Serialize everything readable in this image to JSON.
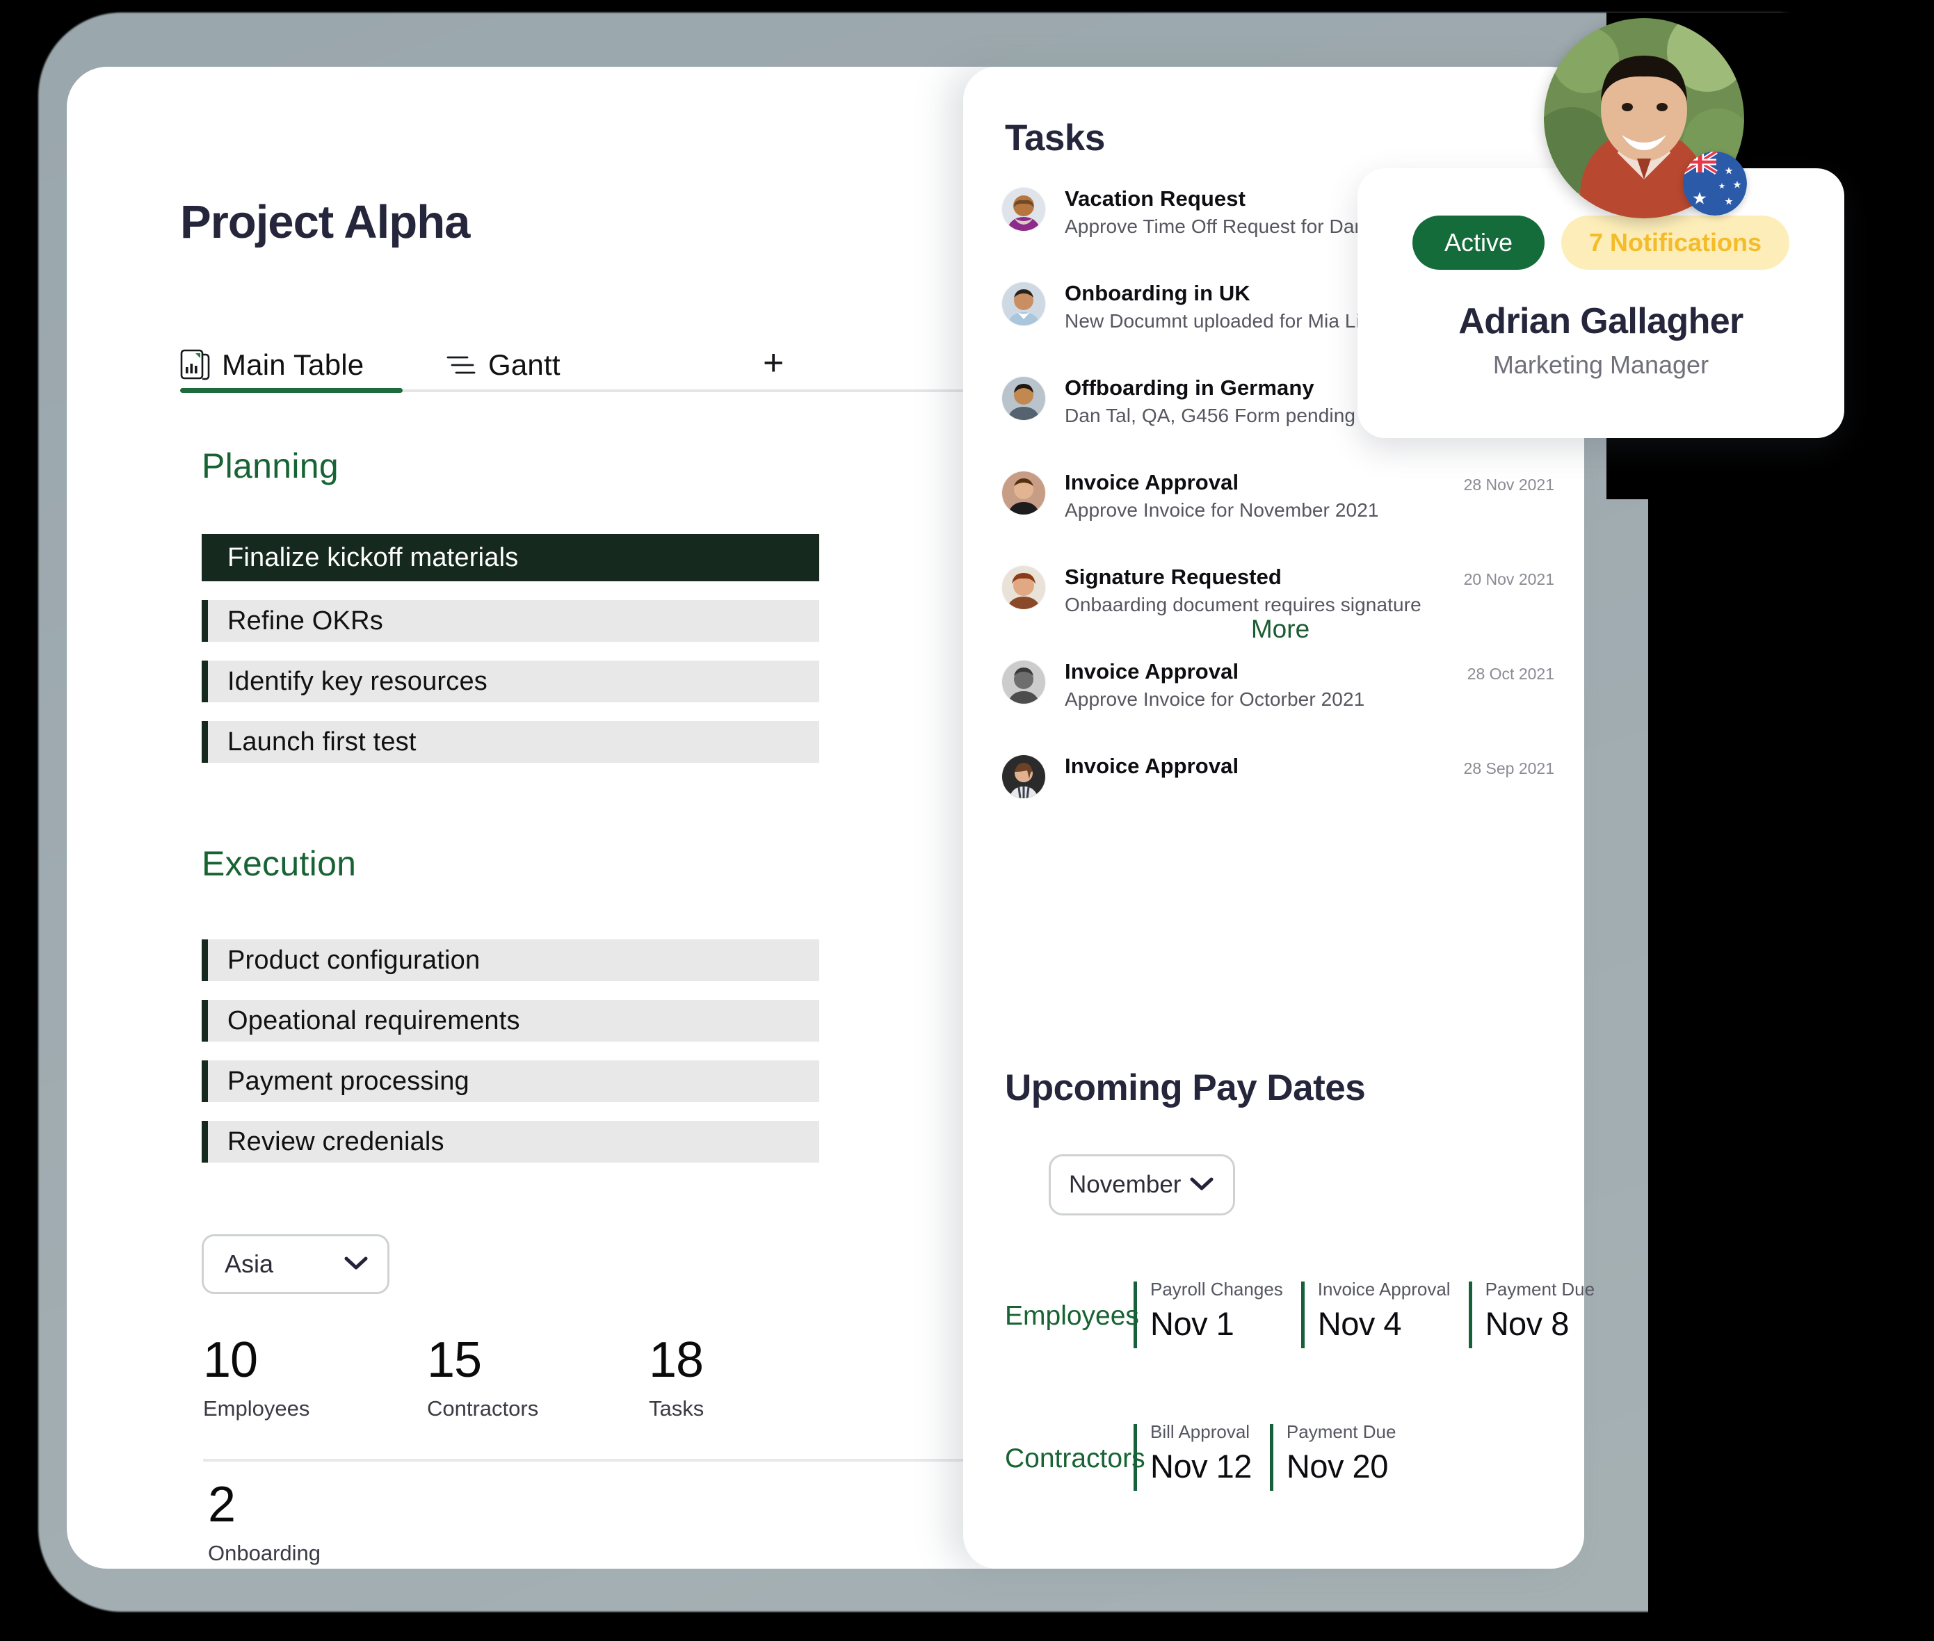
{
  "header": {
    "title": "Project Alpha"
  },
  "tabs": [
    {
      "label": "Main Table",
      "icon": "table-document-icon",
      "active": true
    },
    {
      "label": "Gantt",
      "icon": "gantt-lines-icon",
      "active": false
    }
  ],
  "add_tab_label": "+",
  "sections": [
    {
      "title": "Planning",
      "items": [
        {
          "label": "Finalize kickoff materials",
          "active": true
        },
        {
          "label": "Refine OKRs",
          "active": false
        },
        {
          "label": "Identify key resources",
          "active": false
        },
        {
          "label": "Launch first test",
          "active": false
        }
      ]
    },
    {
      "title": "Execution",
      "items": [
        {
          "label": "Product configuration",
          "active": false
        },
        {
          "label": "Opeational requirements",
          "active": false
        },
        {
          "label": "Payment processing",
          "active": false
        },
        {
          "label": "Review credenials",
          "active": false
        }
      ]
    }
  ],
  "region_select": {
    "value": "Asia"
  },
  "kpis": [
    {
      "value": "10",
      "label": "Employees"
    },
    {
      "value": "15",
      "label": "Contractors"
    },
    {
      "value": "18",
      "label": "Tasks"
    }
  ],
  "kpi_bottom": {
    "value": "2",
    "label": "Onboarding"
  },
  "tasks_panel": {
    "title": "Tasks",
    "more_label": "More",
    "items": [
      {
        "name": "Vacation Request",
        "desc": "Approve Time Off Request for Danny Talio",
        "date": "",
        "avatar": "woman-purple-scarf"
      },
      {
        "name": "Onboarding in UK",
        "desc": "New Documnt uploaded for Mia Lina",
        "date": "",
        "avatar": "man-blue-shirt"
      },
      {
        "name": "Offboarding in Germany",
        "desc": "Dan Tal, QA, G456 Form pending",
        "date": "",
        "avatar": "man-dark-hair"
      },
      {
        "name": "Invoice Approval",
        "desc": "Approve Invoice for November 2021",
        "date": "28 Nov 2021",
        "avatar": "young-man-black-top"
      },
      {
        "name": "Signature Requested",
        "desc": "Onbaarding document requires signature",
        "date": "20 Nov 2021",
        "avatar": "woman-red-hair"
      },
      {
        "name": "Invoice Approval",
        "desc": "Approve Invoice for Octorber 2021",
        "date": "28 Oct 2021",
        "avatar": "woman-greyscale"
      },
      {
        "name": "Invoice Approval",
        "desc": "",
        "date": "28 Sep 2021",
        "avatar": "woman-striped-shirt"
      }
    ]
  },
  "pay_dates": {
    "title": "Upcoming Pay Dates",
    "month_select": {
      "value": "November"
    },
    "groups": [
      {
        "name": "Employees",
        "columns": [
          {
            "header": "Payroll Changes",
            "date": "Nov 1"
          },
          {
            "header": "Invoice Approval",
            "date": "Nov 4"
          },
          {
            "header": "Payment Due",
            "date": "Nov 8"
          }
        ]
      },
      {
        "name": "Contractors",
        "columns": [
          {
            "header": "Bill Approval",
            "date": "Nov 12"
          },
          {
            "header": "Payment Due",
            "date": "Nov 20"
          }
        ]
      }
    ]
  },
  "profile": {
    "status_label": "Active",
    "notifications_label": "7 Notifications",
    "name": "Adrian Gallagher",
    "role": "Marketing Manager",
    "flag": "australia-flag-icon"
  },
  "colors": {
    "accent_green": "#186334",
    "badge_green": "#156c3b",
    "badge_yellow_bg": "#fdeeb9",
    "badge_yellow_text": "#f4bb2a",
    "dark_row": "#16291f",
    "row_grey": "#e8e8e8",
    "title_navy": "#25263b",
    "backdrop": "#9fabb0"
  }
}
